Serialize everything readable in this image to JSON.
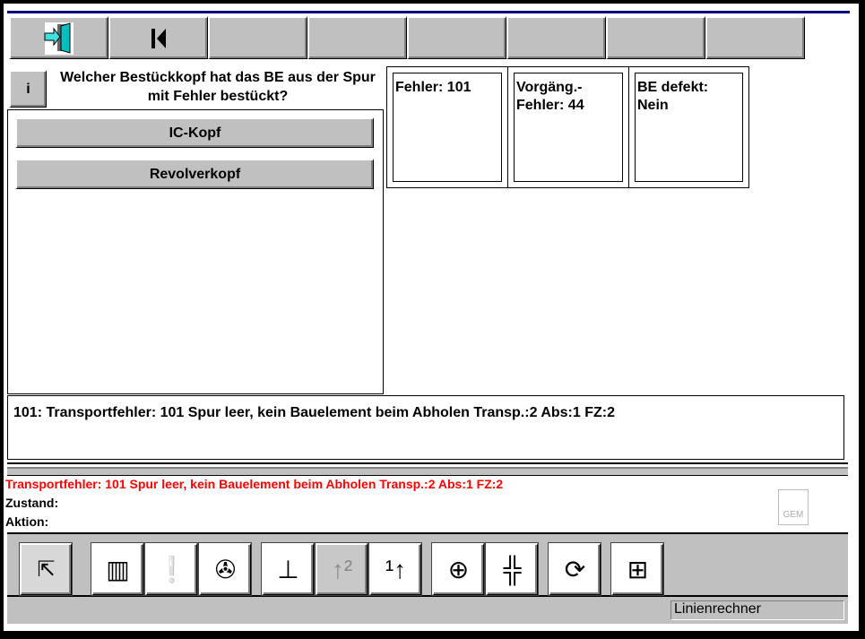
{
  "toolbar": {
    "buttons": [
      {
        "icon": "exit-door-icon"
      },
      {
        "icon": "skip-back-icon",
        "glyph": "⏮"
      },
      {},
      {},
      {},
      {},
      {},
      {}
    ]
  },
  "question": {
    "info_label": "i",
    "text": "Welcher Bestückkopf hat das BE aus der Spur mit Fehler bestückt?",
    "answers": [
      "IC-Kopf",
      "Revolverkopf"
    ]
  },
  "cards": [
    {
      "text": "Fehler: 101"
    },
    {
      "text": "Vorgäng.-\nFehler: 44"
    },
    {
      "text": "BE defekt:\nNein"
    }
  ],
  "message": "101: Transportfehler: 101  Spur leer, kein Bauelement beim Abholen  Transp.:2  Abs:1  FZ:2",
  "status_info": {
    "error_line": "Transportfehler: 101  Spur leer, kein Bauelement beim Abholen  Transp.:2  Abs:1  FZ:2",
    "zustand_label": "Zustand:",
    "aktion_label": "Aktion:",
    "gem_label": "GEM",
    "error_color": "#ff0000"
  },
  "bottom_toolbar": {
    "icons": [
      "select-cursor-icon",
      "feeder-list-icon",
      "alert-icon",
      "reel-icon",
      "placement-head-icon",
      "transport-2-icon",
      "transport-1-icon",
      "camera-add-icon",
      "component-center-icon",
      "rotate-head-icon",
      "line-computer-icon"
    ]
  },
  "statusbar": {
    "field": "Linienrechner"
  }
}
